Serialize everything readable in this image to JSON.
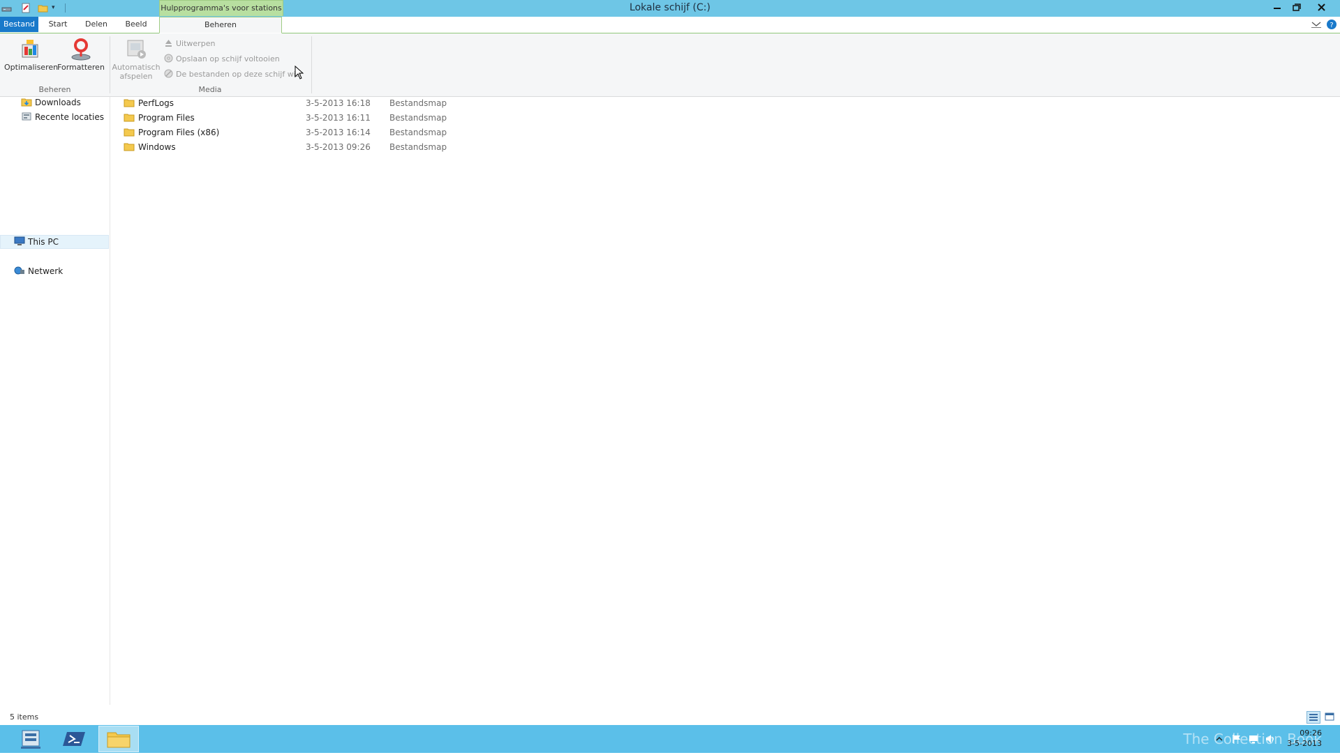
{
  "window": {
    "title": "Lokale schijf (C:)",
    "context_tab_header": "Hulpprogramma's voor stations"
  },
  "ribbon": {
    "tabs": [
      "Bestand",
      "Start",
      "Delen",
      "Beeld",
      "Beheren"
    ],
    "groups": {
      "beheren": {
        "label": "Beheren",
        "optimize": "Optimaliseren",
        "format": "Formatteren"
      },
      "media": {
        "label": "Media",
        "autoplay_line1": "Automatisch",
        "autoplay_line2": "afspelen",
        "eject": "Uitwerpen",
        "finish_burning": "Opslaan op schijf voltooien",
        "erase": "De bestanden op deze schijf wissen"
      }
    }
  },
  "nav": {
    "items": [
      "Downloads",
      "Recente locaties",
      "This PC",
      "Netwerk"
    ]
  },
  "files": [
    {
      "name": "PerfLogs",
      "date": "3-5-2013 16:18",
      "type": "Bestandsmap"
    },
    {
      "name": "Program Files",
      "date": "3-5-2013 16:11",
      "type": "Bestandsmap"
    },
    {
      "name": "Program Files (x86)",
      "date": "3-5-2013 16:14",
      "type": "Bestandsmap"
    },
    {
      "name": "Windows",
      "date": "3-5-2013 09:26",
      "type": "Bestandsmap"
    }
  ],
  "status": {
    "item_count": "5 items"
  },
  "taskbar": {
    "time": "09:26",
    "date": "3-5-2013",
    "watermark": "The Collection Book"
  },
  "colors": {
    "titlebar": "#6ec6e6",
    "file_tab": "#1979ca",
    "context_tab": "#b8dfa0",
    "taskbar": "#5bbfe9"
  }
}
